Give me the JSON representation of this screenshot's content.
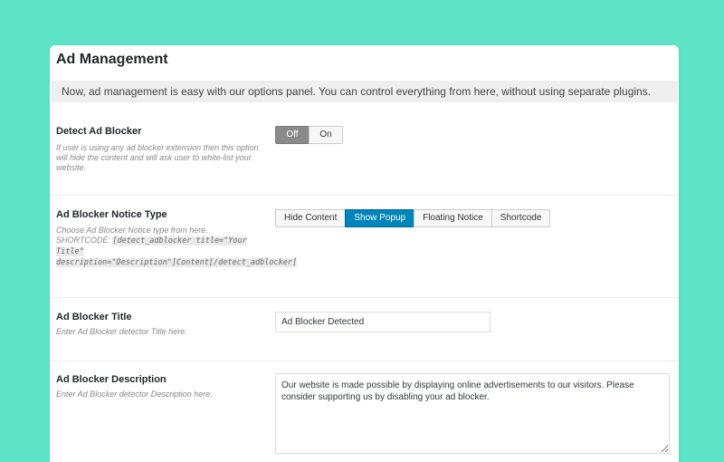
{
  "panel": {
    "title": "Ad Management",
    "notice": "Now, ad management is easy with our options panel. You can control everything from here, without using separate plugins."
  },
  "options": {
    "detect": {
      "title": "Detect Ad Blocker",
      "desc": "If user is using any ad blocker extension then this option will hide the content and will ask user to white-list your website.",
      "buttons": [
        "Off",
        "On"
      ],
      "selected": "Off"
    },
    "notice_type": {
      "title": "Ad Blocker Notice Type",
      "desc_prefix": "Choose Ad Blocker Notice type from here. SHORTCODE:",
      "shortcode": "[detect_adblocker title=\"Your Title\" description=\"Description\"]Content[/detect_adblocker]",
      "buttons": [
        "Hide Content",
        "Show Popup",
        "Floating Notice",
        "Shortcode"
      ],
      "selected": "Show Popup"
    },
    "title_field": {
      "title": "Ad Blocker Title",
      "desc": "Enter Ad Blocker detector Title here.",
      "value": "Ad Blocker Detected"
    },
    "description_field": {
      "title": "Ad Blocker Description",
      "desc": "Enter Ad Blocker detector Description here.",
      "value": "Our website is made possible by displaying online advertisements to our visitors. Please consider supporting us by disabling your ad blocker."
    }
  },
  "colors": {
    "background": "#5ee3c6",
    "active_primary": "#0085ba",
    "active_off": "#8a8a8a"
  }
}
